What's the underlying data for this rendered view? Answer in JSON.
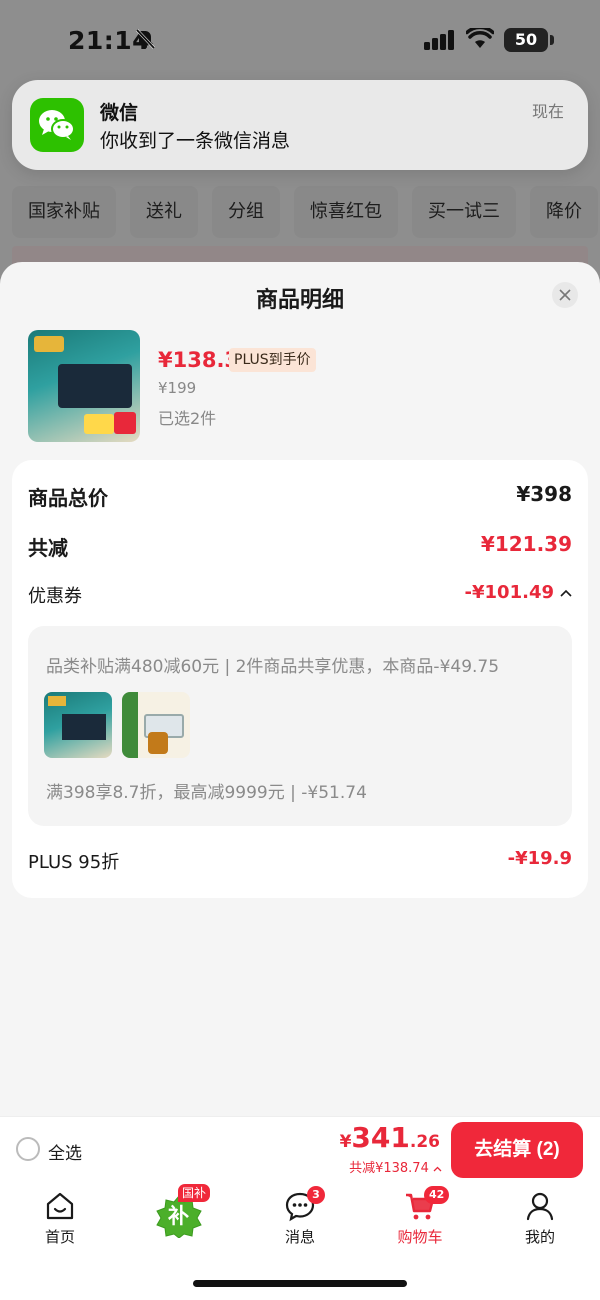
{
  "status_bar": {
    "time": "21:14",
    "battery": "50"
  },
  "background": {
    "tabs": [
      "国家补贴",
      "送礼",
      "分组",
      "惊喜红包",
      "买一试三",
      "降价"
    ]
  },
  "notification": {
    "app": "微信",
    "message": "你收到了一条微信消息",
    "time": "现在"
  },
  "sheet": {
    "title": "商品明细",
    "product": {
      "price": "¥138.3",
      "price_tag": "PLUS到手价",
      "original_price": "¥199",
      "selected": "已选2件"
    },
    "details": {
      "total_label": "商品总价",
      "total_value": "¥398",
      "reduce_label": "共减",
      "reduce_value": "¥121.39",
      "coupon_label": "优惠券",
      "coupon_value": "-¥101.49",
      "coupon_line1": "品类补贴满480减60元 | 2件商品共享优惠，本商品-¥49.75",
      "coupon_line2": "满398享8.7折，最高减9999元 | -¥51.74",
      "plus_label": "PLUS 95折",
      "plus_value": "-¥19.9"
    }
  },
  "checkout": {
    "select_all": "全选",
    "currency": "¥",
    "price_int": "341",
    "price_dec": ".26",
    "reduce_text": "共减¥138.74",
    "button": "去结算 (2)"
  },
  "tabbar": {
    "home": "首页",
    "guobu_badge": "国补",
    "guobu_char": "补",
    "messages": "消息",
    "messages_badge": "3",
    "cart": "购物车",
    "cart_badge": "42",
    "mine": "我的"
  },
  "colors": {
    "accent_red": "#e8283a",
    "wechat_green": "#2dc100"
  }
}
